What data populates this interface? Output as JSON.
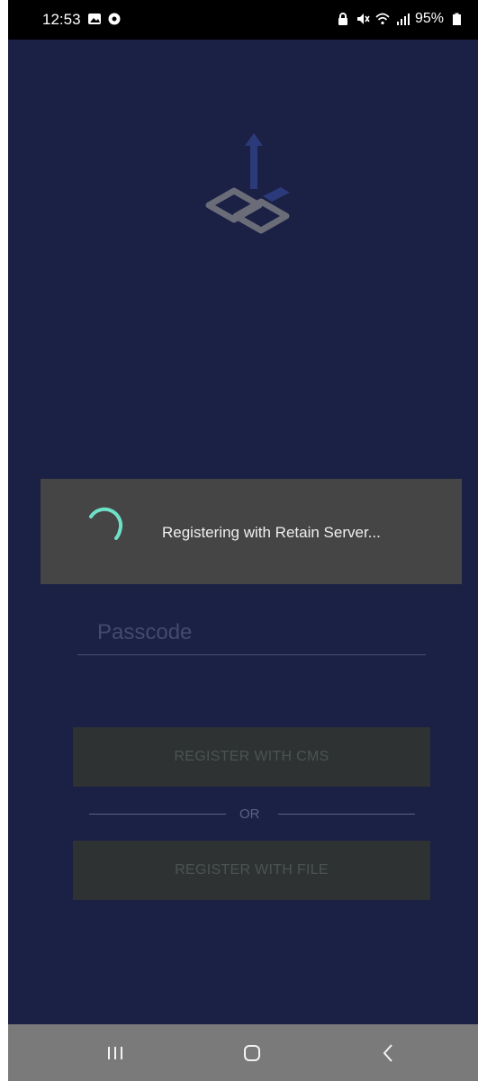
{
  "status_bar": {
    "time": "12:53",
    "battery": "95%",
    "left_icons": [
      "gallery-icon",
      "shield-icon"
    ],
    "right_icons": [
      "lock-icon",
      "mute-icon",
      "wifi-icon",
      "signal-icon",
      "battery-icon"
    ]
  },
  "app": {
    "logo": "app-logo-icon"
  },
  "dialog": {
    "message": "Registering with Retain Server...",
    "accent": "#6fe0c8"
  },
  "form": {
    "passcode_placeholder": "Passcode",
    "register_cms_label": "REGISTER WITH CMS",
    "or_label": "OR",
    "register_file_label": "REGISTER WITH FILE"
  },
  "nav_bar": {
    "buttons": [
      "recents-icon",
      "home-icon",
      "back-icon"
    ]
  },
  "colors": {
    "background": "#1b2045",
    "dialog": "#444544",
    "button": "#2e3232",
    "spinner": "#6fe0c8"
  }
}
